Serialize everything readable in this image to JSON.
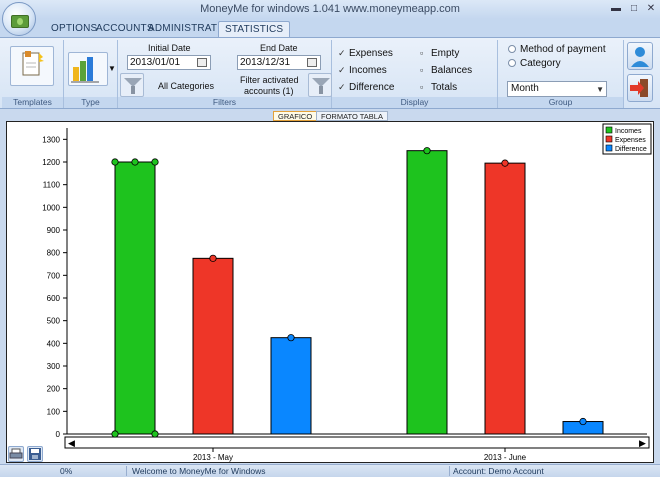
{
  "window": {
    "title": "MoneyMe for windows 1.041 www.moneymeapp.com",
    "min_glyph": "▬",
    "max_glyph": "□",
    "close_glyph": "✕"
  },
  "tabs": [
    {
      "label": "OPTIONS",
      "active": false
    },
    {
      "label": "ACCOUNTS",
      "active": false
    },
    {
      "label": "ADMINISTRATION",
      "active": false
    },
    {
      "label": "STATISTICS",
      "active": true
    }
  ],
  "ribbon": {
    "templates": {
      "group_label": "Templates",
      "icon": "report-template-icon"
    },
    "type": {
      "group_label": "Type",
      "icon": "bar-chart-icon"
    },
    "filters": {
      "group_label": "Filters",
      "initial_date_label": "Initial Date",
      "initial_date_value": "2013/01/01",
      "end_date_label": "End Date",
      "end_date_value": "2013/12/31",
      "categories_label": "All Categories",
      "accounts_filter_line1": "Filter activated",
      "accounts_filter_line2": "accounts (1)"
    },
    "display": {
      "group_label": "Display",
      "options": [
        {
          "label": "Expenses",
          "checked": true
        },
        {
          "label": "Incomes",
          "checked": true
        },
        {
          "label": "Difference",
          "checked": true
        },
        {
          "label": "Empty",
          "checked": false
        },
        {
          "label": "Balances",
          "checked": false
        },
        {
          "label": "Totals",
          "checked": false
        }
      ]
    },
    "group": {
      "group_label": "Group",
      "options": [
        {
          "label": "Method of payment",
          "selected": false
        },
        {
          "label": "Category",
          "selected": false
        }
      ],
      "period_value": "Month"
    }
  },
  "view_tabs": [
    {
      "label": "GRAFICO",
      "active": true
    },
    {
      "label": "FORMATO TABLA",
      "active": false
    }
  ],
  "chart_data": {
    "type": "bar",
    "categories": [
      "2013 - May",
      "2013 - June"
    ],
    "series": [
      {
        "name": "Incomes",
        "color": "#1ec31e",
        "values": [
          1200,
          1250
        ]
      },
      {
        "name": "Expenses",
        "color": "#ee3628",
        "values": [
          775,
          1195
        ]
      },
      {
        "name": "Difference",
        "color": "#0a87ff",
        "values": [
          425,
          55
        ]
      }
    ],
    "y_ticks": [
      0,
      100,
      200,
      300,
      400,
      500,
      600,
      700,
      800,
      900,
      1000,
      1100,
      1200,
      1300
    ],
    "ylim": [
      0,
      1350
    ],
    "legend_position": "top-right",
    "grid": false
  },
  "scroll": {
    "left_glyph": "◀",
    "right_glyph": "▶"
  },
  "statusbar": {
    "progress": "0%",
    "welcome": "Welcome to MoneyMe for Windows",
    "account": "Account: Demo Account"
  }
}
